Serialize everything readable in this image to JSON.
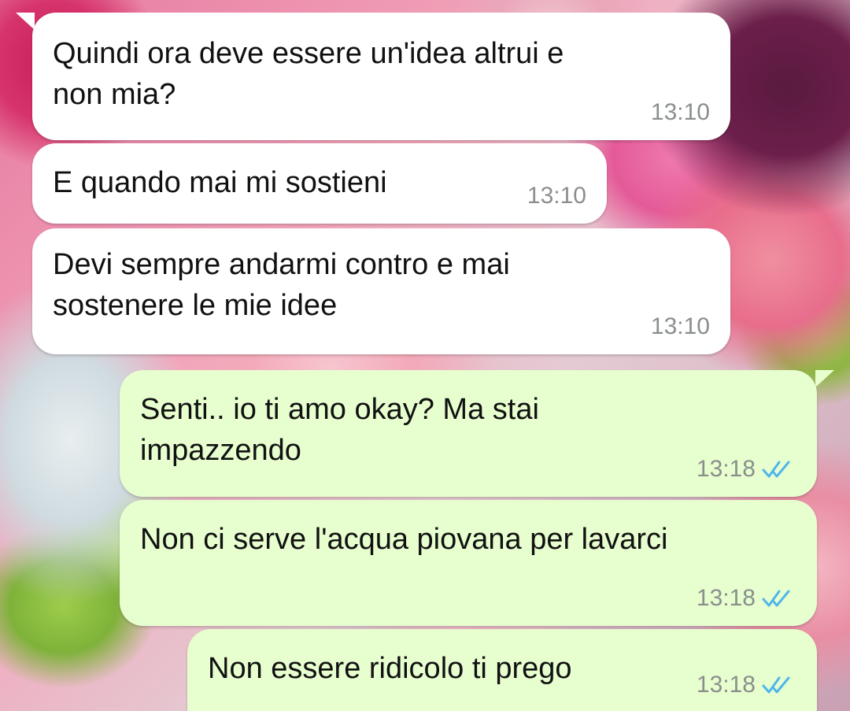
{
  "messages": [
    {
      "direction": "incoming",
      "text": "Quindi ora deve essere un'idea altrui e\nnon mia?",
      "time": "13:10"
    },
    {
      "direction": "incoming",
      "text": "E quando mai mi sostieni",
      "time": "13:10"
    },
    {
      "direction": "incoming",
      "text": "Devi sempre andarmi contro e mai\nsostenere le mie idee",
      "time": "13:10"
    },
    {
      "direction": "outgoing",
      "text": "Senti.. io ti amo okay? Ma stai\nimpazzendo",
      "time": "13:18",
      "status_icon": "double-check-read-icon"
    },
    {
      "direction": "outgoing",
      "text": "Non ci serve l'acqua piovana per lavarci",
      "time": "13:18",
      "status_icon": "double-check-read-icon"
    },
    {
      "direction": "outgoing",
      "text": "Non essere ridicolo ti prego",
      "time": "13:18",
      "status_icon": "double-check-read-icon"
    }
  ],
  "colors": {
    "incoming_bubble": "#ffffff",
    "outgoing_bubble": "#e7fecf",
    "timestamp": "#8a8f8c",
    "read_ticks": "#4fb6ec"
  }
}
